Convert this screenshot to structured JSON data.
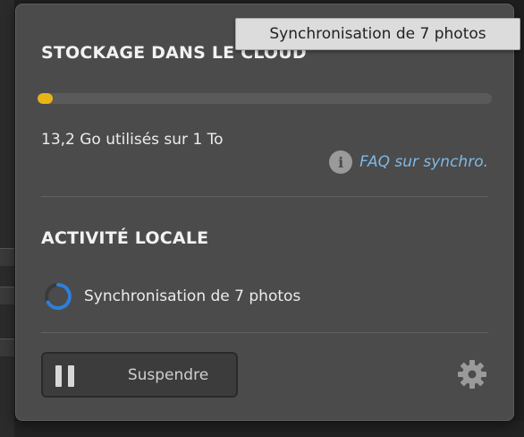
{
  "cloud_storage": {
    "title": "STOCKAGE DANS LE CLOUD",
    "used_fraction": 0.034,
    "usage_text": "13,2 Go utilisés sur 1 To",
    "progress_color": "#e8b416",
    "faq_icon": "info-icon",
    "faq_link": "FAQ sur synchro."
  },
  "local_activity": {
    "title": "ACTIVITÉ LOCALE",
    "status_icon": "spinner-icon",
    "status_text": "Synchronisation de 7 photos"
  },
  "footer": {
    "pause_icon": "pause-icon",
    "pause_label": "Suspendre",
    "settings_icon": "gear-icon"
  },
  "tooltip": {
    "text": "Synchronisation de 7 photos"
  },
  "colors": {
    "link": "#7fb8e4",
    "spinner": "#2f7fd9"
  }
}
